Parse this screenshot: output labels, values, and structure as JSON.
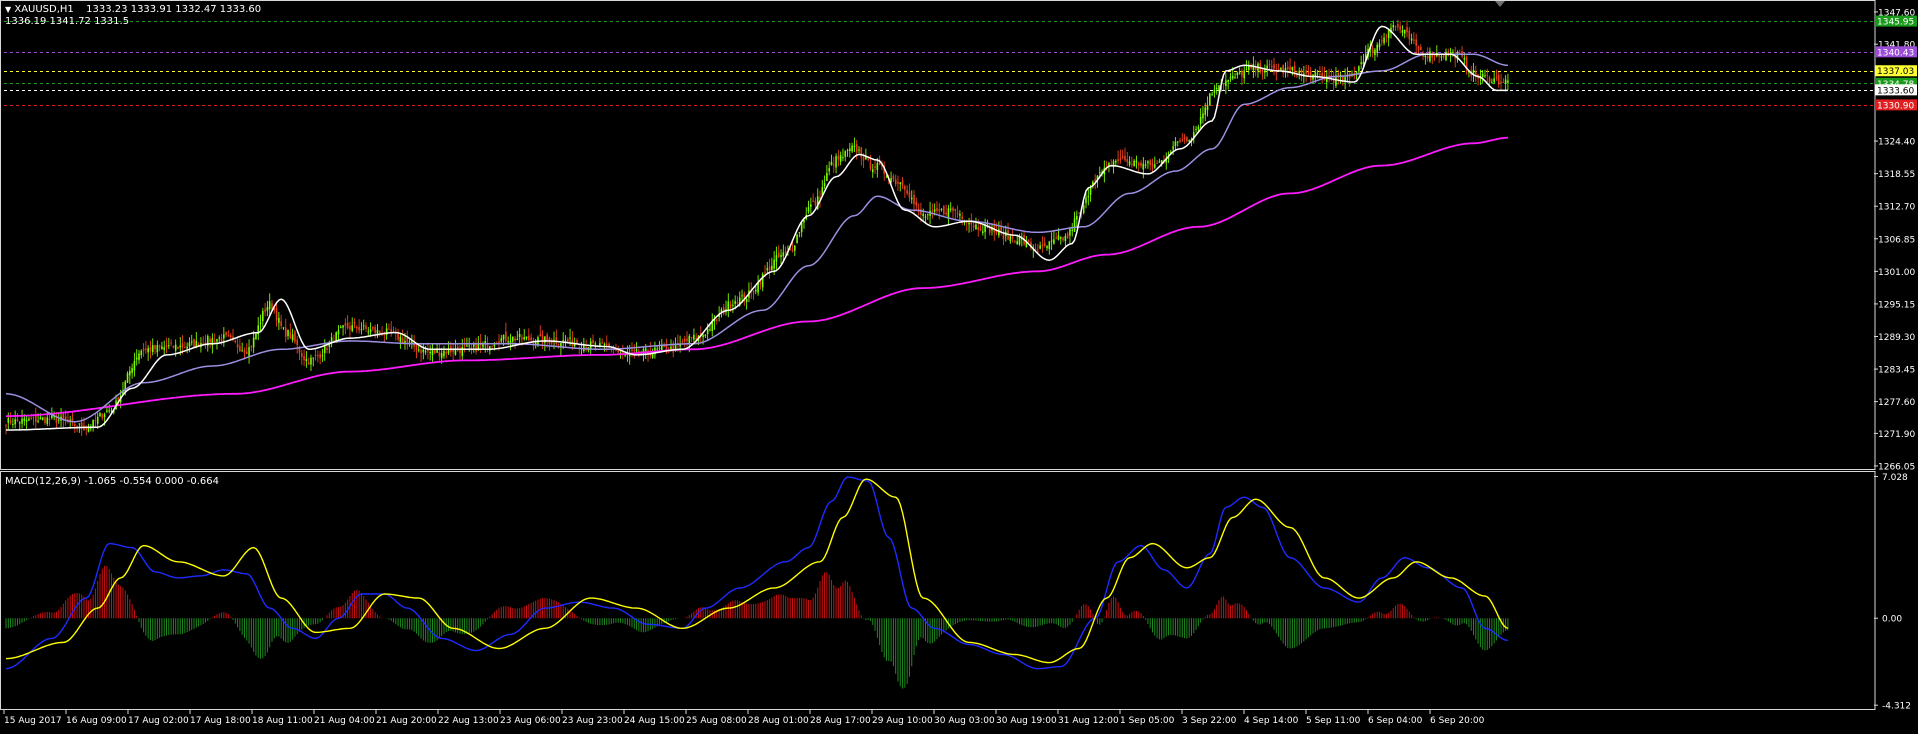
{
  "header": {
    "symbol_label": "XAUUSD,H1",
    "ohlc": "1333.23 1333.91 1332.47 1333.60",
    "info2": "1336.19 1341.72 1331.5"
  },
  "colors": {
    "background": "#000000",
    "frame": "#d8d8d8",
    "axis_text": "#ffffff",
    "bull_candle": "#7cfc00",
    "bear_candle": "#e8401c",
    "ma_fast": "#ffffff",
    "ma_mid": "#9a8fe0",
    "ma_slow": "#ff1bff",
    "macd_line": "#1e2bff",
    "signal_line": "#ffff00",
    "hist_pos": "#cc1010",
    "hist_neg": "#1f8a1f",
    "level_green": "#1a9a1a",
    "level_purple": "#9b4dd8",
    "level_white": "#ffffff",
    "level_yellow": "#ffff33",
    "level_red": "#e02020"
  },
  "chart_data": [
    {
      "type": "candlestick",
      "title": "",
      "y_ticks": [
        "1347.60",
        "1341.80",
        "1324.40",
        "1318.55",
        "1312.70",
        "1306.85",
        "1301.00",
        "1295.15",
        "1289.30",
        "1283.45",
        "1277.60",
        "1271.90",
        "1266.05"
      ],
      "ylim": [
        1265.5,
        1348.3
      ],
      "x_ticks": [
        "15 Aug 2017",
        "16 Aug 09:00",
        "17 Aug 02:00",
        "17 Aug 18:00",
        "18 Aug 11:00",
        "21 Aug 04:00",
        "21 Aug 20:00",
        "22 Aug 13:00",
        "23 Aug 06:00",
        "23 Aug 23:00",
        "24 Aug 15:00",
        "25 Aug 08:00",
        "28 Aug 01:00",
        "28 Aug 17:00",
        "29 Aug 10:00",
        "30 Aug 03:00",
        "30 Aug 19:00",
        "31 Aug 12:00",
        "1 Sep 05:00",
        "3 Sep 22:00",
        "4 Sep 14:00",
        "5 Sep 11:00",
        "6 Sep 04:00",
        "6 Sep 20:00"
      ],
      "close_anchors": [
        [
          0,
          1274
        ],
        [
          20,
          1274.5
        ],
        [
          35,
          1273
        ],
        [
          45,
          1276
        ],
        [
          60,
          1287
        ],
        [
          75,
          1287.5
        ],
        [
          95,
          1289
        ],
        [
          105,
          1287
        ],
        [
          115,
          1295
        ],
        [
          122,
          1290
        ],
        [
          132,
          1285
        ],
        [
          150,
          1291
        ],
        [
          165,
          1290
        ],
        [
          185,
          1286.5
        ],
        [
          200,
          1287
        ],
        [
          220,
          1289
        ],
        [
          240,
          1288.5
        ],
        [
          262,
          1287.5
        ],
        [
          270,
          1286
        ],
        [
          290,
          1287
        ],
        [
          300,
          1289
        ],
        [
          320,
          1296
        ],
        [
          340,
          1304
        ],
        [
          352,
          1313
        ],
        [
          362,
          1321
        ],
        [
          370,
          1323
        ],
        [
          378,
          1320
        ],
        [
          390,
          1317
        ],
        [
          400,
          1311
        ],
        [
          412,
          1312
        ],
        [
          425,
          1309
        ],
        [
          440,
          1307
        ],
        [
          450,
          1305
        ],
        [
          462,
          1307
        ],
        [
          468,
          1311
        ],
        [
          475,
          1318
        ],
        [
          485,
          1321
        ],
        [
          500,
          1320
        ],
        [
          515,
          1325
        ],
        [
          530,
          1335
        ],
        [
          545,
          1337.5
        ],
        [
          560,
          1337
        ],
        [
          570,
          1336
        ],
        [
          585,
          1335.5
        ],
        [
          596,
          1341
        ],
        [
          605,
          1345
        ],
        [
          620,
          1340
        ],
        [
          632,
          1340
        ],
        [
          642,
          1336
        ],
        [
          655,
          1335
        ]
      ],
      "ma_fast_anchors": [
        [
          0,
          1272.5
        ],
        [
          40,
          1273
        ],
        [
          55,
          1280
        ],
        [
          70,
          1286
        ],
        [
          90,
          1288
        ],
        [
          110,
          1290
        ],
        [
          120,
          1296
        ],
        [
          132,
          1287
        ],
        [
          150,
          1289
        ],
        [
          170,
          1290
        ],
        [
          185,
          1287
        ],
        [
          210,
          1287
        ],
        [
          235,
          1288.5
        ],
        [
          262,
          1287.5
        ],
        [
          275,
          1286
        ],
        [
          295,
          1287
        ],
        [
          315,
          1294
        ],
        [
          335,
          1301
        ],
        [
          350,
          1311
        ],
        [
          362,
          1318
        ],
        [
          372,
          1322
        ],
        [
          380,
          1321
        ],
        [
          392,
          1312
        ],
        [
          405,
          1309
        ],
        [
          420,
          1310
        ],
        [
          440,
          1307.5
        ],
        [
          455,
          1303
        ],
        [
          465,
          1306
        ],
        [
          472,
          1316
        ],
        [
          482,
          1320
        ],
        [
          498,
          1318.5
        ],
        [
          512,
          1323
        ],
        [
          526,
          1328
        ],
        [
          532,
          1337
        ],
        [
          540,
          1338
        ],
        [
          555,
          1337
        ],
        [
          570,
          1336
        ],
        [
          588,
          1335
        ],
        [
          600,
          1345
        ],
        [
          615,
          1340
        ],
        [
          630,
          1340
        ],
        [
          642,
          1336
        ],
        [
          650,
          1333.5
        ],
        [
          655,
          1333.5
        ]
      ],
      "ma_mid_anchors": [
        [
          0,
          1279
        ],
        [
          30,
          1274
        ],
        [
          60,
          1281
        ],
        [
          90,
          1284
        ],
        [
          120,
          1287
        ],
        [
          150,
          1288.5
        ],
        [
          180,
          1288
        ],
        [
          220,
          1288
        ],
        [
          260,
          1287
        ],
        [
          300,
          1288
        ],
        [
          330,
          1294
        ],
        [
          350,
          1302
        ],
        [
          370,
          1311
        ],
        [
          380,
          1314.5
        ],
        [
          395,
          1312
        ],
        [
          420,
          1310
        ],
        [
          450,
          1308
        ],
        [
          470,
          1309
        ],
        [
          490,
          1315
        ],
        [
          510,
          1319
        ],
        [
          526,
          1323
        ],
        [
          540,
          1331
        ],
        [
          560,
          1334
        ],
        [
          580,
          1336
        ],
        [
          600,
          1337
        ],
        [
          620,
          1340
        ],
        [
          640,
          1340
        ],
        [
          655,
          1338
        ]
      ],
      "ma_slow_anchors": [
        [
          0,
          1275
        ],
        [
          100,
          1279
        ],
        [
          150,
          1283
        ],
        [
          200,
          1285
        ],
        [
          260,
          1286
        ],
        [
          300,
          1287
        ],
        [
          350,
          1292
        ],
        [
          400,
          1298
        ],
        [
          450,
          1301
        ],
        [
          480,
          1304
        ],
        [
          520,
          1309
        ],
        [
          560,
          1315
        ],
        [
          600,
          1320
        ],
        [
          640,
          1324
        ],
        [
          655,
          1325
        ]
      ],
      "levels": [
        {
          "value": "1345.95",
          "role": "green"
        },
        {
          "value": "1340.43",
          "role": "purple"
        },
        {
          "value": "1337.03",
          "role": "yellow"
        },
        {
          "value": "1334.78",
          "role": "green"
        },
        {
          "value": "1333.60",
          "role": "white"
        },
        {
          "value": "1330.90",
          "role": "red"
        }
      ],
      "bars": 656,
      "seed": 7
    },
    {
      "type": "macd",
      "indicator_label": "MACD(12,26,9) -1.065 -0.554 0.000 -0.664",
      "y_ticks": [
        "7.028",
        "0.00",
        "-4.312"
      ],
      "ylim": [
        -4.55,
        7.3
      ],
      "macd_anchors": [
        [
          0,
          -2.5
        ],
        [
          20,
          -1
        ],
        [
          35,
          1
        ],
        [
          45,
          3.7
        ],
        [
          55,
          3.5
        ],
        [
          65,
          2.3
        ],
        [
          75,
          2
        ],
        [
          85,
          2.1
        ],
        [
          95,
          2.4
        ],
        [
          105,
          2.2
        ],
        [
          115,
          0.5
        ],
        [
          125,
          -0.5
        ],
        [
          135,
          -1
        ],
        [
          145,
          0
        ],
        [
          155,
          1.2
        ],
        [
          165,
          1.2
        ],
        [
          175,
          0.5
        ],
        [
          190,
          -1
        ],
        [
          205,
          -1.6
        ],
        [
          220,
          -0.8
        ],
        [
          235,
          0.5
        ],
        [
          250,
          0.8
        ],
        [
          265,
          0.5
        ],
        [
          280,
          -0.3
        ],
        [
          295,
          -0.5
        ],
        [
          305,
          0.5
        ],
        [
          320,
          1.5
        ],
        [
          340,
          2.8
        ],
        [
          350,
          3.5
        ],
        [
          360,
          5.8
        ],
        [
          367,
          7
        ],
        [
          376,
          6.8
        ],
        [
          385,
          4
        ],
        [
          395,
          0.5
        ],
        [
          405,
          -0.5
        ],
        [
          420,
          -1.3
        ],
        [
          435,
          -1.8
        ],
        [
          450,
          -2.5
        ],
        [
          460,
          -2.4
        ],
        [
          475,
          0
        ],
        [
          485,
          2.8
        ],
        [
          495,
          3.6
        ],
        [
          505,
          2.4
        ],
        [
          515,
          1.5
        ],
        [
          525,
          3.2
        ],
        [
          532,
          5.5
        ],
        [
          540,
          6
        ],
        [
          548,
          5.5
        ],
        [
          560,
          3
        ],
        [
          575,
          1.5
        ],
        [
          590,
          0.8
        ],
        [
          600,
          2
        ],
        [
          610,
          3
        ],
        [
          620,
          2.5
        ],
        [
          635,
          1.5
        ],
        [
          645,
          -0.5
        ],
        [
          655,
          -1.1
        ]
      ],
      "signal_anchors": [
        [
          0,
          -2
        ],
        [
          25,
          -1.2
        ],
        [
          40,
          0.5
        ],
        [
          50,
          2
        ],
        [
          60,
          3.6
        ],
        [
          75,
          2.8
        ],
        [
          95,
          2.1
        ],
        [
          108,
          3.5
        ],
        [
          120,
          1
        ],
        [
          135,
          -0.7
        ],
        [
          150,
          -0.5
        ],
        [
          165,
          1.2
        ],
        [
          180,
          1
        ],
        [
          195,
          -0.5
        ],
        [
          215,
          -1.5
        ],
        [
          235,
          -0.5
        ],
        [
          255,
          1
        ],
        [
          275,
          0.5
        ],
        [
          295,
          -0.5
        ],
        [
          315,
          0.5
        ],
        [
          335,
          1.5
        ],
        [
          355,
          2.8
        ],
        [
          365,
          5
        ],
        [
          375,
          6.9
        ],
        [
          388,
          6
        ],
        [
          400,
          1
        ],
        [
          420,
          -1.2
        ],
        [
          440,
          -1.8
        ],
        [
          455,
          -2.2
        ],
        [
          468,
          -1.5
        ],
        [
          480,
          1
        ],
        [
          490,
          3
        ],
        [
          500,
          3.7
        ],
        [
          515,
          2.5
        ],
        [
          525,
          3
        ],
        [
          535,
          5
        ],
        [
          545,
          5.9
        ],
        [
          560,
          4.5
        ],
        [
          575,
          2
        ],
        [
          590,
          1
        ],
        [
          605,
          2
        ],
        [
          615,
          2.8
        ],
        [
          630,
          2
        ],
        [
          645,
          1.1
        ],
        [
          655,
          -0.5
        ]
      ]
    }
  ]
}
